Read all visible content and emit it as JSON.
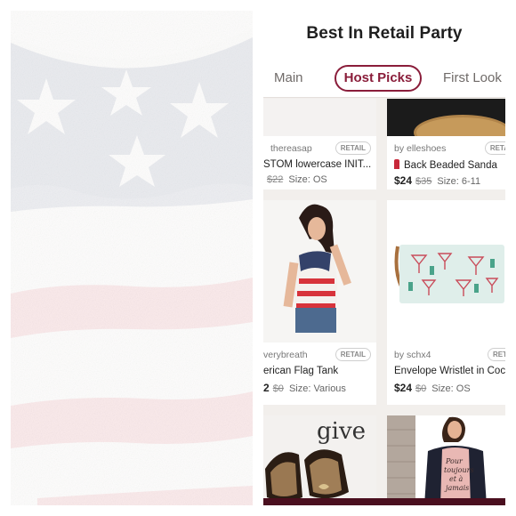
{
  "app": {
    "title": "Best In Retail Party",
    "tabs": [
      {
        "label": "Main"
      },
      {
        "label": "Host Picks",
        "active": true
      },
      {
        "label": "First Look"
      }
    ],
    "accent_color": "#8a1d3a"
  },
  "listings": [
    {
      "seller": "thereasap",
      "badge": "RETAIL",
      "title": "STOM lowercase INIT...",
      "price": "",
      "original_price": "$22",
      "size": "Size: OS"
    },
    {
      "seller": "by elleshoes",
      "badge": "RETA",
      "title": "Back Beaded Sanda",
      "title_icon": "lipstick-icon",
      "price": "$24",
      "original_price": "$35",
      "size": "Size: 6-11"
    },
    {
      "seller": "verybreath",
      "badge": "RETAIL",
      "title": "erican Flag Tank",
      "price": "2",
      "original_price": "$0",
      "size": "Size: Various"
    },
    {
      "seller": "by schx4",
      "badge": "RET",
      "title": "Envelope Wristlet in Coc",
      "price": "$24",
      "original_price": "$0",
      "size": "Size: OS"
    }
  ],
  "photo_text": {
    "give_sign": "give",
    "cardigan_print": [
      "Pour",
      "toujours",
      "et à",
      "jamais"
    ]
  },
  "colors": {
    "flag_blue": "#2f3e63",
    "flag_red": "#d8323a",
    "shirt_white": "#f6f3ee"
  }
}
